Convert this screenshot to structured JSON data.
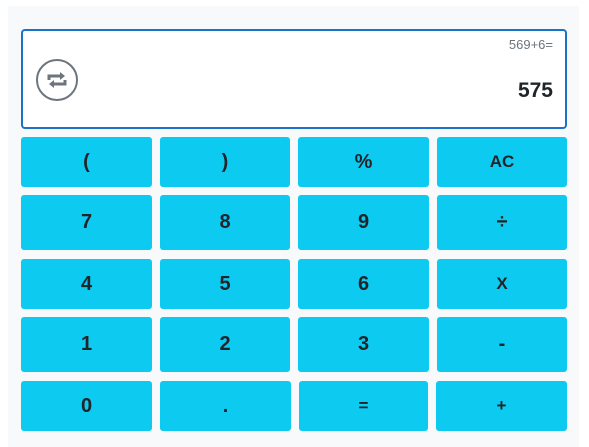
{
  "display": {
    "expression": "569+6=",
    "result": "575",
    "history_icon": "history-cycle-icon"
  },
  "keys": {
    "open_paren": "(",
    "close_paren": ")",
    "percent": "%",
    "clear": "AC",
    "seven": "7",
    "eight": "8",
    "nine": "9",
    "divide": "÷",
    "four": "4",
    "five": "5",
    "six": "6",
    "multiply": "X",
    "one": "1",
    "two": "2",
    "three": "3",
    "minus": "-",
    "zero": "0",
    "decimal": ".",
    "equals": "=",
    "plus": "+"
  },
  "colors": {
    "key_background": "#0dcaf0",
    "display_border": "#1b73c9",
    "key_text": "#212529"
  }
}
